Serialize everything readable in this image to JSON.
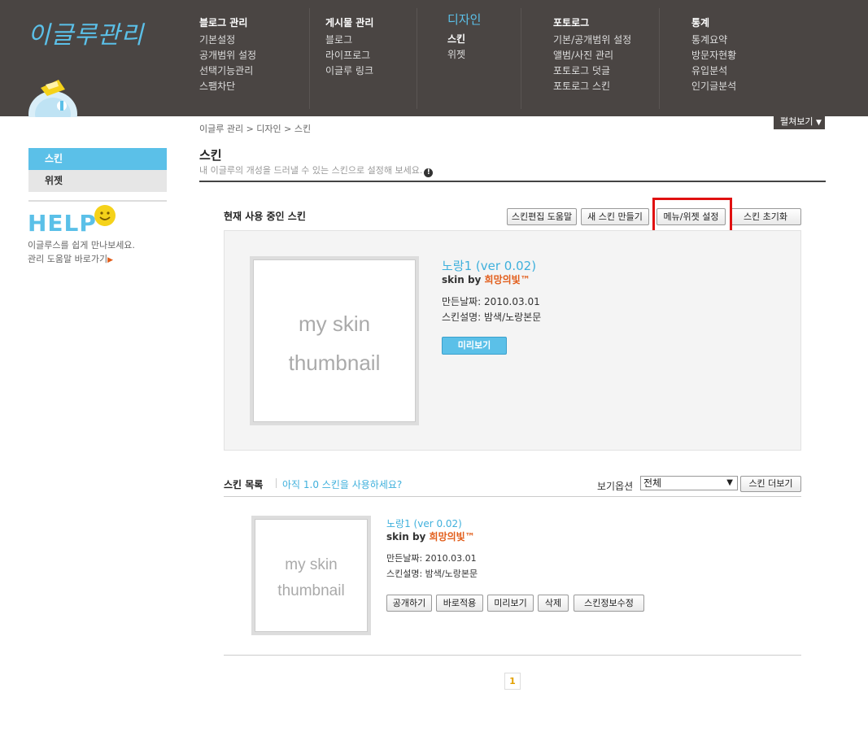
{
  "header": {
    "logo_text": "이글루관리",
    "nav": [
      {
        "title": "블로그 관리",
        "items": [
          "기본설정",
          "공개범위 설정",
          "선택기능관리",
          "스팸차단"
        ]
      },
      {
        "title": "게시물 관리",
        "items": [
          "블로그",
          "라이프로그",
          "이글루 링크"
        ]
      },
      {
        "title": "디자인",
        "items": [
          "스킨",
          "위젯"
        ]
      },
      {
        "title": "포토로그",
        "items": [
          "기본/공개범위 설정",
          "앨범/사진 관리",
          "포토로그 덧글",
          "포토로그 스킨"
        ]
      },
      {
        "title": "통계",
        "items": [
          "통계요약",
          "방문자현황",
          "유입분석",
          "인기글분석"
        ]
      }
    ]
  },
  "breadcrumb": "이글루 관리 > 디자인 > 스킨",
  "expand_button": "펼쳐보기",
  "sidebar": {
    "items": [
      "스킨",
      "위젯"
    ],
    "help_title": "HELP",
    "help_line1": "이글루스를 쉽게 만나보세요.",
    "help_line2": "관리 도움말 바로가기"
  },
  "main": {
    "title": "스킨",
    "subtitle": "내 이글루의 개성을 드러낼 수 있는 스킨으로 설정해 보세요."
  },
  "current_skin": {
    "label": "현재 사용 중인 스킨",
    "buttons": [
      "스킨편집 도움말",
      "새 스킨 만들기",
      "메뉴/위젯 설정",
      "스킨 초기화"
    ],
    "thumb_line1": "my skin",
    "thumb_line2": "thumbnail",
    "name": "노랑1 (ver 0.02)",
    "by_prefix": "skin by ",
    "author": "희망의빛™",
    "date": "만든날짜: 2010.03.01",
    "desc": "스킨설명: 밤색/노랑본문",
    "preview_button": "미리보기"
  },
  "skin_list": {
    "label": "스킨 목록",
    "link": "아직 1.0 스킨을 사용하세요?",
    "view_label": "보기옵션",
    "view_selected": "전체",
    "more_button": "스킨 더보기",
    "item": {
      "thumb_line1": "my skin",
      "thumb_line2": "thumbnail",
      "name": "노랑1 (ver 0.02)",
      "by_prefix": "skin by ",
      "author": "희망의빛™",
      "date": "만든날짜: 2010.03.01",
      "desc": "스킨설명: 밤색/노랑본문",
      "buttons": [
        "공개하기",
        "바로적용",
        "미리보기",
        "삭제",
        "스킨정보수정"
      ]
    }
  },
  "pagination": {
    "current": "1"
  },
  "colors": {
    "header_bg": "#4a4543",
    "accent": "#5bc0e8",
    "author": "#e25d1a",
    "highlight": "#e01010"
  }
}
